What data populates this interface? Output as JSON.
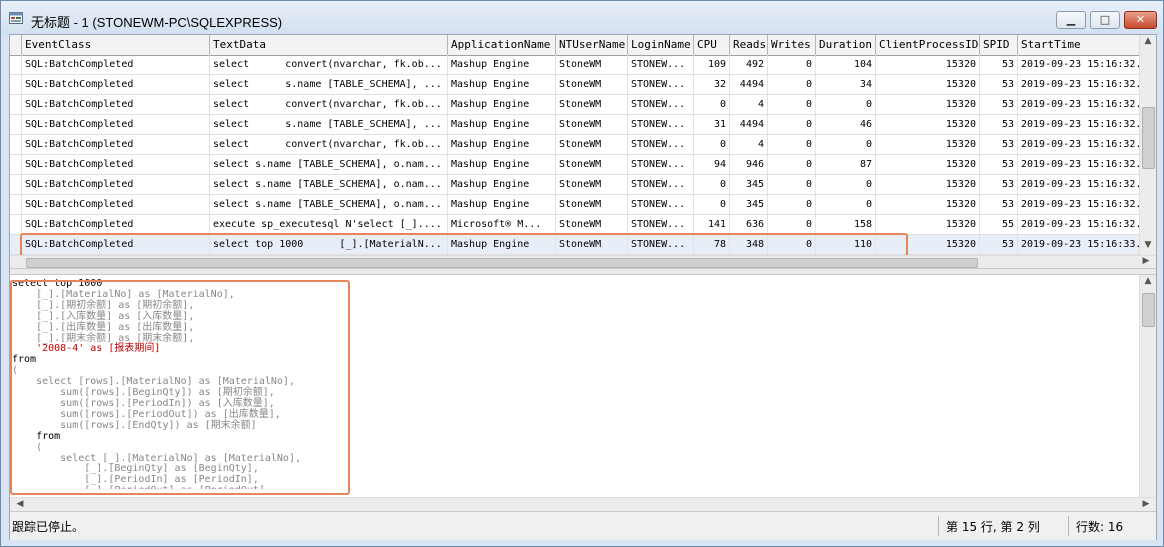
{
  "window": {
    "title": "无标题 - 1 (STONEWM-PC\\SQLEXPRESS)",
    "minimize_label": "▁",
    "maximize_label": "□",
    "close_label": "✕"
  },
  "grid": {
    "columns": [
      "EventClass",
      "TextData",
      "ApplicationName",
      "NTUserName",
      "LoginName",
      "CPU",
      "Reads",
      "Writes",
      "Duration",
      "ClientProcessID",
      "SPID",
      "StartTime"
    ],
    "rows": [
      [
        "SQL:BatchCompleted",
        "select      convert(nvarchar, fk.ob...",
        "Mashup Engine",
        "StoneWM",
        "STONEW...",
        "109",
        "492",
        "0",
        "104",
        "15320",
        "53",
        "2019-09-23 15:16:32."
      ],
      [
        "SQL:BatchCompleted",
        "select      s.name [TABLE_SCHEMA], ...",
        "Mashup Engine",
        "StoneWM",
        "STONEW...",
        "32",
        "4494",
        "0",
        "34",
        "15320",
        "53",
        "2019-09-23 15:16:32."
      ],
      [
        "SQL:BatchCompleted",
        "select      convert(nvarchar, fk.ob...",
        "Mashup Engine",
        "StoneWM",
        "STONEW...",
        "0",
        "4",
        "0",
        "0",
        "15320",
        "53",
        "2019-09-23 15:16:32."
      ],
      [
        "SQL:BatchCompleted",
        "select      s.name [TABLE_SCHEMA], ...",
        "Mashup Engine",
        "StoneWM",
        "STONEW...",
        "31",
        "4494",
        "0",
        "46",
        "15320",
        "53",
        "2019-09-23 15:16:32."
      ],
      [
        "SQL:BatchCompleted",
        "select      convert(nvarchar, fk.ob...",
        "Mashup Engine",
        "StoneWM",
        "STONEW...",
        "0",
        "4",
        "0",
        "0",
        "15320",
        "53",
        "2019-09-23 15:16:32."
      ],
      [
        "SQL:BatchCompleted",
        "select s.name [TABLE_SCHEMA], o.nam...",
        "Mashup Engine",
        "StoneWM",
        "STONEW...",
        "94",
        "946",
        "0",
        "87",
        "15320",
        "53",
        "2019-09-23 15:16:32."
      ],
      [
        "SQL:BatchCompleted",
        "select s.name [TABLE_SCHEMA], o.nam...",
        "Mashup Engine",
        "StoneWM",
        "STONEW...",
        "0",
        "345",
        "0",
        "0",
        "15320",
        "53",
        "2019-09-23 15:16:32."
      ],
      [
        "SQL:BatchCompleted",
        "select s.name [TABLE_SCHEMA], o.nam...",
        "Mashup Engine",
        "StoneWM",
        "STONEW...",
        "0",
        "345",
        "0",
        "0",
        "15320",
        "53",
        "2019-09-23 15:16:32."
      ],
      [
        "SQL:BatchCompleted",
        "execute sp_executesql N'select [_]....",
        "Microsoft® M...",
        "StoneWM",
        "STONEW...",
        "141",
        "636",
        "0",
        "158",
        "15320",
        "55",
        "2019-09-23 15:16:32."
      ],
      [
        "SQL:BatchCompleted",
        "select top 1000      [_].[MaterialN...",
        "Mashup Engine",
        "StoneWM",
        "STONEW...",
        "78",
        "348",
        "0",
        "110",
        "15320",
        "53",
        "2019-09-23 15:16:33."
      ]
    ],
    "selected_row_index": 9
  },
  "sql_text": [
    {
      "t": "select top 1000",
      "c": "kw"
    },
    {
      "t": "    [_].[MaterialNo] as [MaterialNo],",
      "c": "pn"
    },
    {
      "t": "    [_].[期初余额] as [期初余额],",
      "c": "pn"
    },
    {
      "t": "    [_].[入库数量] as [入库数量],",
      "c": "pn"
    },
    {
      "t": "    [_].[出库数量] as [出库数量],",
      "c": "pn"
    },
    {
      "t": "    [_].[期末余额] as [期末余额],",
      "c": "pn"
    },
    {
      "t": "    '2008-4' as [报表期间]",
      "c": "str"
    },
    {
      "t": "from",
      "c": "kw"
    },
    {
      "t": "(",
      "c": "pn"
    },
    {
      "t": "    select [rows].[MaterialNo] as [MaterialNo],",
      "c": "pn"
    },
    {
      "t": "        sum([rows].[BeginQty]) as [期初余额],",
      "c": "pn"
    },
    {
      "t": "        sum([rows].[PeriodIn]) as [入库数量],",
      "c": "pn"
    },
    {
      "t": "        sum([rows].[PeriodOut]) as [出库数量],",
      "c": "pn"
    },
    {
      "t": "        sum([rows].[EndQty]) as [期末余额]",
      "c": "pn"
    },
    {
      "t": "    from",
      "c": "kw"
    },
    {
      "t": "    (",
      "c": "pn"
    },
    {
      "t": "        select [_].[MaterialNo] as [MaterialNo],",
      "c": "pn"
    },
    {
      "t": "            [_].[BeginQty] as [BeginQty],",
      "c": "pn"
    },
    {
      "t": "            [_].[PeriodIn] as [PeriodIn],",
      "c": "pn"
    },
    {
      "t": "            [_].[PeriodOut] as [PeriodOut],",
      "c": "pn"
    }
  ],
  "statusbar": {
    "message": "跟踪已停止。",
    "position": "第 15 行, 第 2 列",
    "row_count": "行数: 16"
  },
  "icons": {
    "app": "profiler-window-icon",
    "scroll_up": "▲",
    "scroll_down": "▼",
    "scroll_left": "◀",
    "scroll_right": "▶"
  },
  "colors": {
    "highlight_outline": "#e8845a",
    "selected_row": "#e8eef7",
    "string_literal": "#c00000"
  }
}
